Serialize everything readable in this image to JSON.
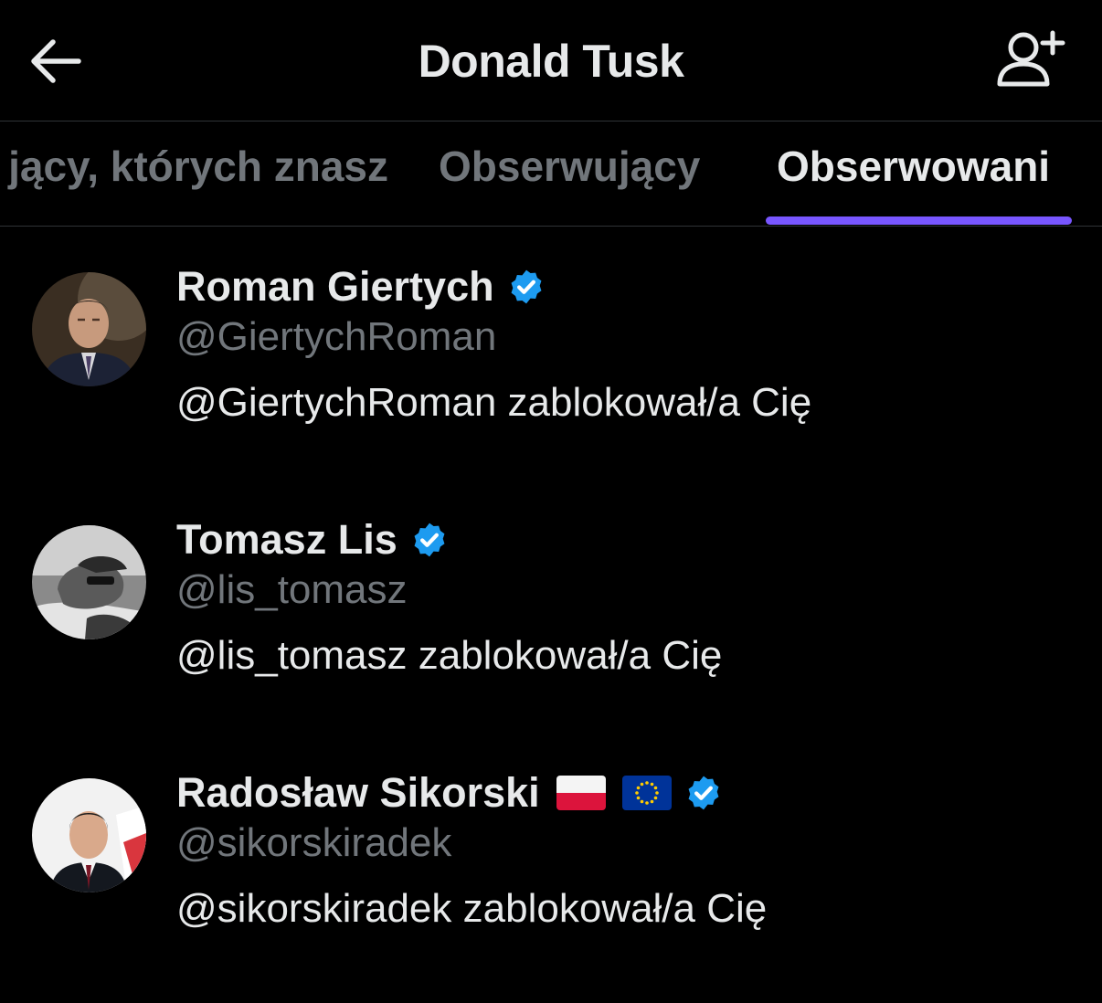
{
  "header": {
    "title": "Donald Tusk"
  },
  "tabs": [
    {
      "label": "jący, których znasz"
    },
    {
      "label": "Obserwujący"
    },
    {
      "label": "Obserwowani"
    }
  ],
  "colors": {
    "background": "#000000",
    "text_primary": "#e7e9ea",
    "text_secondary": "#71767b",
    "tab_indicator": "#7856ff",
    "verified_badge": "#1d9bf0",
    "divider": "#2f3336"
  },
  "icons": {
    "back": "arrow-left-icon",
    "follow": "person-plus-icon",
    "verified": "verified-badge-icon"
  },
  "users": [
    {
      "name": "Roman Giertych",
      "handle": "@GiertychRoman",
      "blocked_text": "@GiertychRoman zablokował/a Cię",
      "verified": true
    },
    {
      "name": "Tomasz Lis",
      "handle": "@lis_tomasz",
      "blocked_text": "@lis_tomasz zablokował/a Cię",
      "verified": true
    },
    {
      "name": "Radosław Sikorski",
      "handle": "@sikorskiradek",
      "blocked_text": "@sikorskiradek zablokował/a Cię",
      "verified": true,
      "flags": [
        "poland-flag",
        "eu-flag"
      ]
    }
  ]
}
